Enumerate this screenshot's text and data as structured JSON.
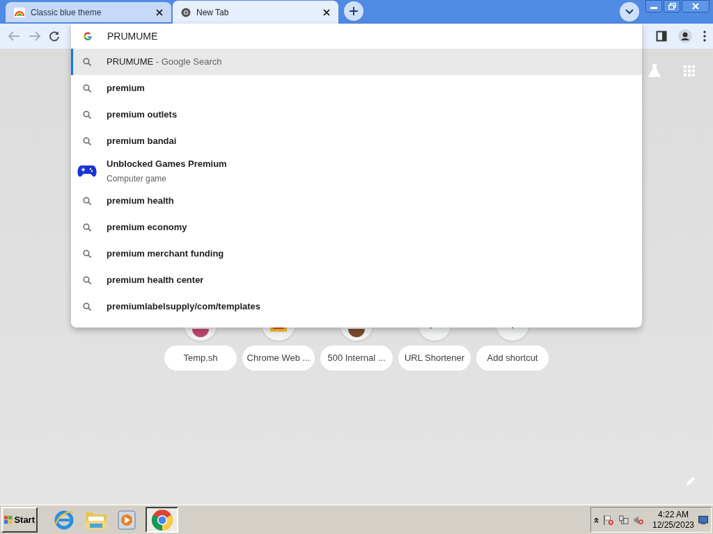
{
  "tabs": [
    {
      "title": "Classic blue theme",
      "selected": false
    },
    {
      "title": "New Tab",
      "selected": true
    }
  ],
  "omnibox": {
    "value": "PRUMUME"
  },
  "suggestions": [
    {
      "kind": "search",
      "text": "PRUMUME",
      "suffix": "- Google Search",
      "selected": true
    },
    {
      "kind": "search",
      "text": "premium",
      "selected": false
    },
    {
      "kind": "search",
      "text": "premium outlets",
      "selected": false
    },
    {
      "kind": "search",
      "text": "premium bandai",
      "selected": false
    },
    {
      "kind": "entity",
      "text": "Unblocked Games Premium",
      "subtitle": "Computer game",
      "selected": false
    },
    {
      "kind": "search",
      "text": "premium health",
      "selected": false
    },
    {
      "kind": "search",
      "text": "premium economy",
      "selected": false
    },
    {
      "kind": "search",
      "text": "premium merchant funding",
      "selected": false
    },
    {
      "kind": "search",
      "text": "premium health center",
      "selected": false
    },
    {
      "kind": "search",
      "text": "premiumlabelsupply/com/templates",
      "selected": false
    }
  ],
  "shortcuts": [
    {
      "label": "Temp.sh",
      "kind": "dot",
      "color": "#c0466e"
    },
    {
      "label": "Chrome Web ...",
      "kind": "store"
    },
    {
      "label": "500 Internal ...",
      "kind": "dot",
      "color": "#7a4b2c"
    },
    {
      "label": "URL Shortener",
      "kind": "link"
    },
    {
      "label": "Add shortcut",
      "kind": "add"
    }
  ],
  "taskbar": {
    "start": "Start",
    "time": "4:22 AM",
    "date": "12/25/2023"
  }
}
